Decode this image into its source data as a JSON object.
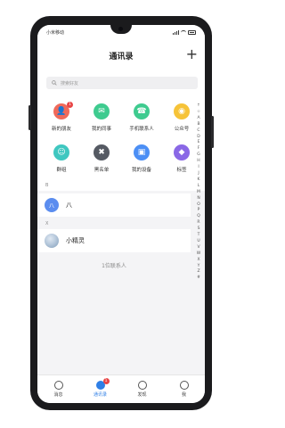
{
  "status_bar": {
    "carrier": "小米移动"
  },
  "header": {
    "title": "通讯录",
    "add_label": "+"
  },
  "search": {
    "placeholder": "搜索好友"
  },
  "grid": {
    "items": [
      {
        "label": "新的朋友",
        "icon": "user-plus-icon",
        "color": "#f06a5a",
        "badge": "1"
      },
      {
        "label": "我的同事",
        "icon": "briefcase-icon",
        "color": "#3ecb8f",
        "badge": ""
      },
      {
        "label": "手机联系人",
        "icon": "phone-contact-icon",
        "color": "#3ecb8f",
        "badge": ""
      },
      {
        "label": "公众号",
        "icon": "public-account-icon",
        "color": "#f6c338",
        "badge": ""
      },
      {
        "label": "群组",
        "icon": "group-icon",
        "color": "#3fc7c0",
        "badge": ""
      },
      {
        "label": "黑名单",
        "icon": "blacklist-icon",
        "color": "#555a63",
        "badge": ""
      },
      {
        "label": "我的设备",
        "icon": "device-icon",
        "color": "#4c8ff5",
        "badge": ""
      },
      {
        "label": "标签",
        "icon": "tag-icon",
        "color": "#8a68e6",
        "badge": ""
      }
    ]
  },
  "sections": [
    {
      "letter": "B",
      "contacts": [
        {
          "name": "八",
          "avatar_text": "八",
          "avatar_color": "#5b8def"
        }
      ]
    },
    {
      "letter": "X",
      "contacts": [
        {
          "name": "小精灵",
          "avatar_text": "",
          "avatar_color": "#9fb6cf"
        }
      ]
    }
  ],
  "footer": {
    "count_text": "1位联系人"
  },
  "index_letters": [
    "↑",
    "☆",
    "A",
    "B",
    "C",
    "D",
    "E",
    "F",
    "G",
    "H",
    "I",
    "J",
    "K",
    "L",
    "M",
    "N",
    "O",
    "P",
    "Q",
    "R",
    "S",
    "T",
    "U",
    "V",
    "W",
    "X",
    "Y",
    "Z",
    "#"
  ],
  "tabbar": {
    "tabs": [
      {
        "label": "消息",
        "icon": "message-icon",
        "active": false,
        "badge": ""
      },
      {
        "label": "通讯录",
        "icon": "contacts-icon",
        "active": true,
        "badge": "1"
      },
      {
        "label": "发现",
        "icon": "discover-icon",
        "active": false,
        "badge": ""
      },
      {
        "label": "我",
        "icon": "profile-icon",
        "active": false,
        "badge": ""
      }
    ]
  },
  "colors": {
    "accent": "#2f7fe6",
    "badge": "#e84545"
  }
}
